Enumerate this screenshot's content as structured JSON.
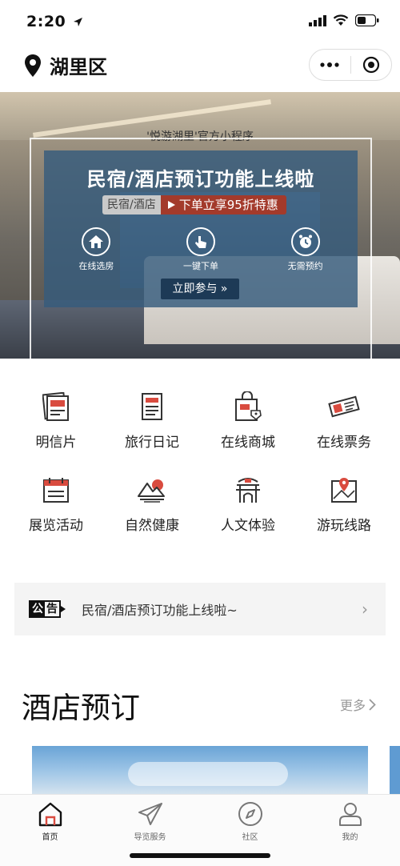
{
  "status_bar": {
    "time": "2:20"
  },
  "nav": {
    "location": "湖里区"
  },
  "banner": {
    "subtitle": "'悦游湖里'官方小程序",
    "title": "民宿/酒店预订功能上线啦",
    "tag_gray": "民宿/酒店",
    "tag_red": "下单立享95折特惠",
    "features": [
      {
        "label": "在线选房",
        "icon": "house-icon"
      },
      {
        "label": "一键下单",
        "icon": "tap-icon"
      },
      {
        "label": "无需预约",
        "icon": "alarm-clock-icon"
      }
    ],
    "join_button": "立即参与 »"
  },
  "grid": {
    "items": [
      {
        "label": "明信片",
        "icon": "postcard-icon"
      },
      {
        "label": "旅行日记",
        "icon": "diary-icon"
      },
      {
        "label": "在线商城",
        "icon": "shopping-bag-icon"
      },
      {
        "label": "在线票务",
        "icon": "ticket-icon"
      },
      {
        "label": "展览活动",
        "icon": "calendar-icon"
      },
      {
        "label": "自然健康",
        "icon": "mountain-sun-icon"
      },
      {
        "label": "人文体验",
        "icon": "pavilion-icon"
      },
      {
        "label": "游玩线路",
        "icon": "map-pin-icon"
      }
    ]
  },
  "notice": {
    "badge_a": "公",
    "badge_b": "告",
    "text": "民宿/酒店预订功能上线啦~",
    "arrow": "›"
  },
  "hotel_section": {
    "title": "酒店预订",
    "more": "更多"
  },
  "tab_bar": {
    "items": [
      {
        "label": "首页",
        "icon": "home-icon",
        "active": true
      },
      {
        "label": "导览服务",
        "icon": "paper-plane-icon",
        "active": false
      },
      {
        "label": "社区",
        "icon": "compass-icon",
        "active": false
      },
      {
        "label": "我的",
        "icon": "user-icon",
        "active": false
      }
    ]
  },
  "colors": {
    "accent_red": "#d94b3f",
    "banner_card": "#365c7d",
    "tag_red": "#a33a2b"
  }
}
